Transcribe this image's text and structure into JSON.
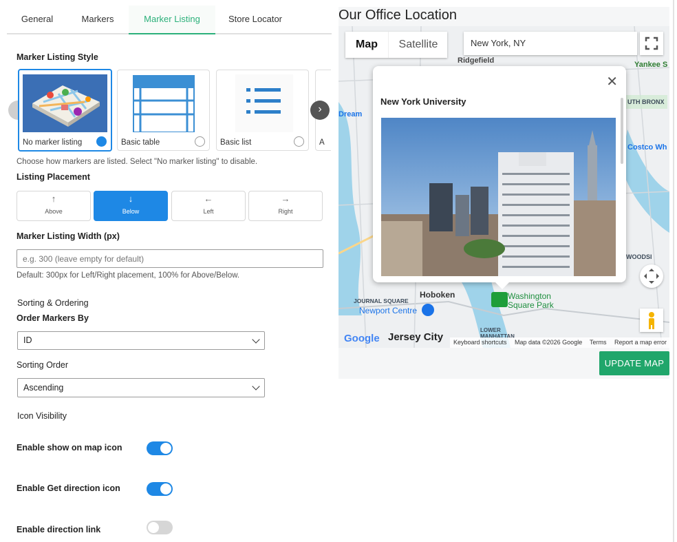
{
  "tabs": [
    {
      "label": "General"
    },
    {
      "label": "Markers"
    },
    {
      "label": "Marker Listing"
    },
    {
      "label": "Store Locator"
    }
  ],
  "listing_style": {
    "title": "Marker Listing Style",
    "options": [
      {
        "label": "No marker listing",
        "selected": true
      },
      {
        "label": "Basic table",
        "selected": false
      },
      {
        "label": "Basic list",
        "selected": false
      },
      {
        "label": "A",
        "selected": false
      }
    ],
    "hint": "Choose how markers are listed. Select \"No marker listing\" to disable."
  },
  "placement": {
    "title": "Listing Placement",
    "options": [
      {
        "label": "Above",
        "icon": "arrow-up-icon"
      },
      {
        "label": "Below",
        "icon": "arrow-down-icon"
      },
      {
        "label": "Left",
        "icon": "arrow-left-icon"
      },
      {
        "label": "Right",
        "icon": "arrow-right-icon"
      }
    ],
    "selected": "Below"
  },
  "width": {
    "title": "Marker Listing Width (px)",
    "placeholder": "e.g. 300 (leave empty for default)",
    "hint": "Default: 300px for Left/Right placement, 100% for Above/Below."
  },
  "sorting": {
    "section": "Sorting & Ordering",
    "order_by_label": "Order Markers By",
    "order_by_value": "ID",
    "order_label": "Sorting Order",
    "order_value": "Ascending"
  },
  "icons": {
    "section": "Icon Visibility",
    "items": [
      {
        "label": "Enable show on map icon",
        "on": true
      },
      {
        "label": "Enable Get direction icon",
        "on": true
      },
      {
        "label": "Enable direction link",
        "on": false
      }
    ]
  },
  "map": {
    "title": "Our Office Location",
    "type_map": "Map",
    "type_satellite": "Satellite",
    "search_value": "New York, NY",
    "info_title": "New York University",
    "labels": {
      "ridgefield": "Ridgefield",
      "yankee": "Yankee S",
      "south_bronx": "UTH BRONX",
      "costco": "Costco Wh",
      "dream": "Dream",
      "hoboken": "Hoboken",
      "journal": "JOURNAL SQUARE",
      "newport": "Newport Centre",
      "washington": "Washington Square Park",
      "jersey": "Jersey City",
      "lower": "LOWER MANHATTAN",
      "woodsi": "WOODSI"
    },
    "footer": {
      "google": "Google",
      "shortcuts": "Keyboard shortcuts",
      "data": "Map data ©2026 Google",
      "terms": "Terms",
      "report": "Report a map error"
    },
    "update_label": "UPDATE MAP",
    "colors": {
      "accent": "#1e88e5",
      "update": "#20a66b",
      "tab_active": "#2bb07a"
    }
  }
}
